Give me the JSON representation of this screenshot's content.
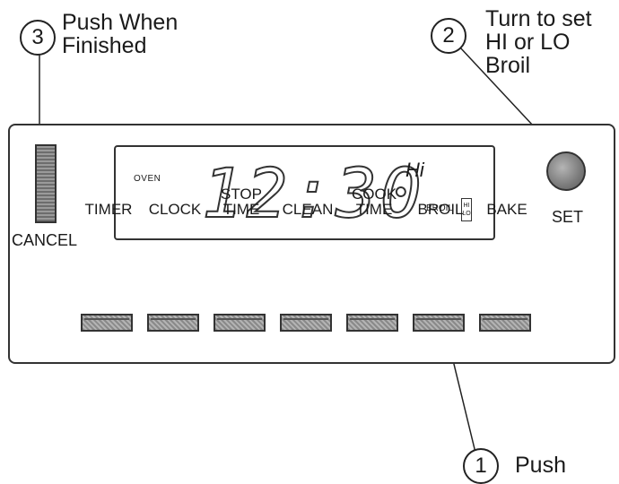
{
  "callouts": {
    "push_finished": {
      "number": "3",
      "text": "Push When\nFinished"
    },
    "turn_set": {
      "number": "2",
      "text": "Turn to set\nHI or LO\nBroil"
    },
    "push": {
      "number": "1",
      "text": "Push"
    }
  },
  "panel": {
    "cancel_label": "CANCEL",
    "display": {
      "oven_label": "OVEN",
      "time": "12:30",
      "hi_label": "Hi",
      "broil_label": "BROIL",
      "hi_lo": [
        "HI",
        "LO"
      ]
    },
    "set_label": "SET",
    "keys": [
      {
        "label": "TIMER"
      },
      {
        "label": "CLOCK"
      },
      {
        "label": "STOP\nTIME"
      },
      {
        "label": "CLEAN"
      },
      {
        "label": "COOK\nTIME"
      },
      {
        "label": "BROIL"
      },
      {
        "label": "BAKE"
      }
    ]
  }
}
